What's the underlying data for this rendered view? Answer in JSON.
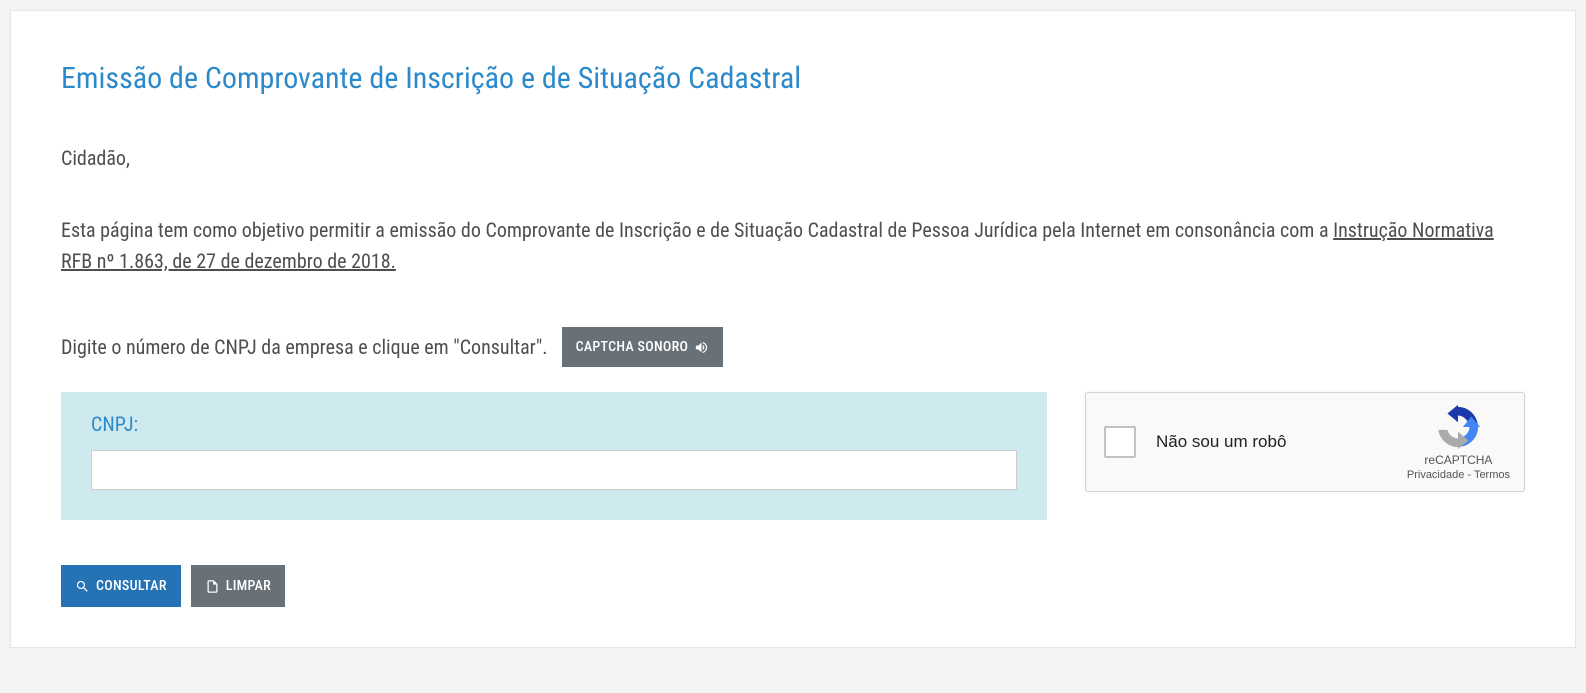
{
  "page": {
    "title": "Emissão de Comprovante de Inscrição e de Situação Cadastral",
    "greeting": "Cidadão,",
    "description_pre": "Esta página tem como objetivo permitir a emissão do Comprovante de Inscrição e de Situação Cadastral de Pessoa Jurídica pela Internet em consonância com a ",
    "description_link": "Instrução Normativa RFB nº 1.863, de 27 de dezembro de 2018.",
    "instruction": "Digite o número de CNPJ da empresa e clique em \"Consultar\"."
  },
  "captcha_button": {
    "label": "CAPTCHA SONORO"
  },
  "form": {
    "cnpj_label": "CNPJ:",
    "cnpj_value": ""
  },
  "recaptcha": {
    "label": "Não sou um robô",
    "brand": "reCAPTCHA",
    "privacy": "Privacidade",
    "separator": " - ",
    "terms": "Termos"
  },
  "actions": {
    "consultar": "CONSULTAR",
    "limpar": "LIMPAR"
  }
}
